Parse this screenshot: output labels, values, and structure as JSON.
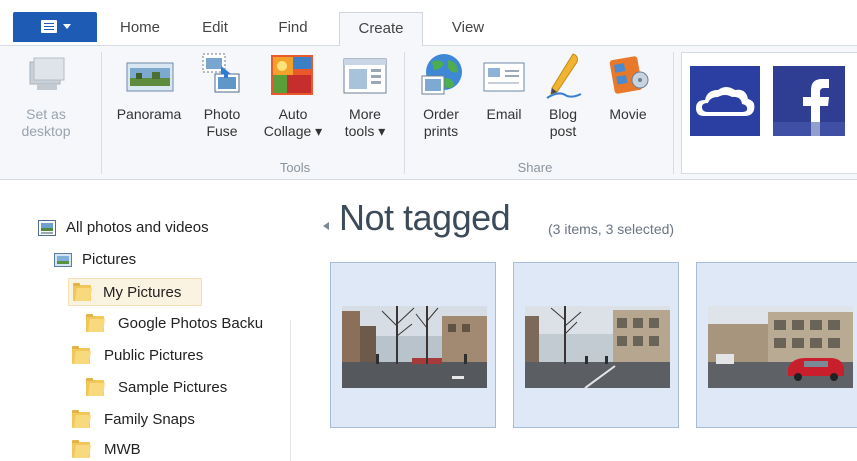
{
  "ribbon": {
    "tabs": [
      {
        "label": "Home",
        "active": false
      },
      {
        "label": "Edit",
        "active": false
      },
      {
        "label": "Find",
        "active": false
      },
      {
        "label": "Create",
        "active": true
      },
      {
        "label": "View",
        "active": false
      }
    ],
    "buttons": {
      "set_as_desktop": "Set as\ndesktop",
      "panorama": "Panorama",
      "photo_fuse": "Photo\nFuse",
      "auto_collage": "Auto\nCollage ▾",
      "more_tools": "More\ntools ▾",
      "order_prints": "Order\nprints",
      "email": "Email",
      "blog_post": "Blog\npost",
      "movie": "Movie"
    },
    "groups": {
      "tools": "Tools",
      "share": "Share"
    },
    "share_services": [
      "onedrive",
      "facebook"
    ],
    "colors": {
      "accent": "#1e5bb5",
      "onedrive": "#2b3ea1",
      "facebook": "#2f3d92"
    }
  },
  "tree": {
    "items": [
      {
        "label": "All photos and videos",
        "icon": "photos-library-icon",
        "selected": false
      },
      {
        "label": "Pictures",
        "icon": "pictures-library-icon",
        "selected": false
      },
      {
        "label": "My Pictures",
        "icon": "folder-icon",
        "selected": true
      },
      {
        "label": "Google Photos Backu",
        "icon": "folder-icon",
        "selected": false
      },
      {
        "label": "Public Pictures",
        "icon": "folder-icon",
        "selected": false
      },
      {
        "label": "Sample Pictures",
        "icon": "folder-icon",
        "selected": false
      },
      {
        "label": "Family Snaps",
        "icon": "folder-icon",
        "selected": false
      },
      {
        "label": "MWB",
        "icon": "folder-icon",
        "selected": false
      }
    ]
  },
  "main": {
    "group_title": "Not tagged",
    "group_count": "(3 items, 3 selected)",
    "thumbnails": [
      {
        "selected": true
      },
      {
        "selected": true
      },
      {
        "selected": true
      }
    ]
  }
}
